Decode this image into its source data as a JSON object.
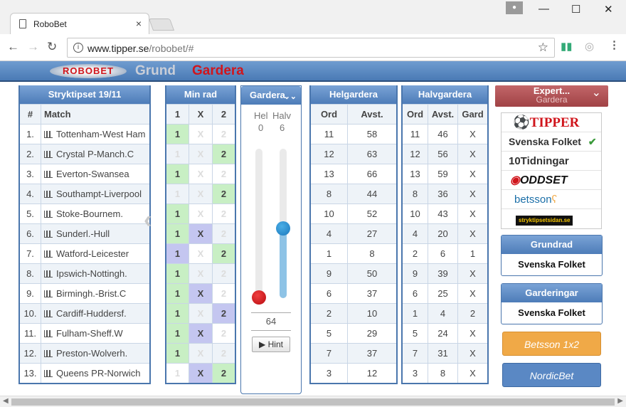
{
  "browser": {
    "tab_title": "RoboBet",
    "tab_close": "×",
    "url_host": "www.tipper.se",
    "url_path": "/robobet/#",
    "min": "—",
    "max": "☐",
    "close": "✕"
  },
  "banner": {
    "logo": "ROBOBET",
    "grund": "Grund",
    "gardera": "Gardera"
  },
  "stryk": {
    "title": "Stryktipset 19/11",
    "col_num": "#",
    "col_match": "Match",
    "matches": [
      "Tottenham-West Ham",
      "Crystal P-Manch.C",
      "Everton-Swansea",
      "Southampt-Liverpool",
      "Stoke-Bournem.",
      "Sunderl.-Hull",
      "Watford-Leicester",
      "Ipswich-Nottingh.",
      "Birmingh.-Brist.C",
      "Cardiff-Huddersf.",
      "Fulham-Sheff.W",
      "Preston-Wolverh.",
      "Queens PR-Norwich"
    ],
    "nums": [
      "1.",
      "2.",
      "3.",
      "4.",
      "5.",
      "6.",
      "7.",
      "8.",
      "9.",
      "10.",
      "11.",
      "12.",
      "13."
    ]
  },
  "minrad": {
    "title": "Min rad",
    "cols": [
      "1",
      "X",
      "2"
    ],
    "rows": [
      [
        "1",
        "",
        ""
      ],
      [
        "",
        "",
        "2"
      ],
      [
        "1",
        "",
        ""
      ],
      [
        "",
        "",
        "2"
      ],
      [
        "1",
        "",
        ""
      ],
      [
        "1",
        "X",
        ""
      ],
      [
        "1",
        "",
        "2"
      ],
      [
        "1",
        "",
        ""
      ],
      [
        "1",
        "X",
        ""
      ],
      [
        "1",
        "",
        "2"
      ],
      [
        "1",
        "X",
        ""
      ],
      [
        "1",
        "",
        ""
      ],
      [
        "",
        "X",
        "2"
      ]
    ],
    "faint": [
      "1",
      "X",
      "2"
    ]
  },
  "gardera": {
    "title": "Gardera",
    "hel_label": "Hel",
    "halv_label": "Halv",
    "hel_value": "0",
    "halv_value": "6",
    "total": "64",
    "hint": "▶ Hint"
  },
  "helgardera": {
    "title": "Helgardera",
    "cols": [
      "Ord",
      "Avst."
    ],
    "rows": [
      [
        "11",
        "58"
      ],
      [
        "12",
        "63"
      ],
      [
        "13",
        "66"
      ],
      [
        "8",
        "44"
      ],
      [
        "10",
        "52"
      ],
      [
        "4",
        "27"
      ],
      [
        "1",
        "8"
      ],
      [
        "9",
        "50"
      ],
      [
        "6",
        "37"
      ],
      [
        "2",
        "10"
      ],
      [
        "5",
        "29"
      ],
      [
        "7",
        "37"
      ],
      [
        "3",
        "12"
      ]
    ]
  },
  "halvgardera": {
    "title": "Halvgardera",
    "cols": [
      "Ord",
      "Avst.",
      "Gard"
    ],
    "rows": [
      [
        "11",
        "46",
        "X"
      ],
      [
        "12",
        "56",
        "X"
      ],
      [
        "13",
        "59",
        "X"
      ],
      [
        "8",
        "36",
        "X"
      ],
      [
        "10",
        "43",
        "X"
      ],
      [
        "4",
        "20",
        "X"
      ],
      [
        "2",
        "6",
        "1"
      ],
      [
        "9",
        "39",
        "X"
      ],
      [
        "6",
        "25",
        "X"
      ],
      [
        "1",
        "4",
        "2"
      ],
      [
        "5",
        "24",
        "X"
      ],
      [
        "7",
        "31",
        "X"
      ],
      [
        "3",
        "8",
        "X"
      ]
    ]
  },
  "expert": {
    "line1": "Expert...",
    "line2": "Gardera"
  },
  "sources": [
    "TIPPER",
    "Svenska Folket",
    "10Tidningar",
    "ODDSET",
    "betsson",
    "stryktipsetsidan.se"
  ],
  "grundrad": {
    "title": "Grundrad",
    "value": "Svenska Folket"
  },
  "garderingar": {
    "title": "Garderingar",
    "value": "Svenska Folket"
  },
  "betsson_btn": "Betsson 1x2",
  "nordic_btn": "NordicBet",
  "colors": {
    "accent": "#4d7cb8",
    "red": "#d0151c",
    "green_cell": "#c8efc4",
    "purple_cell": "#c4c6f0",
    "betsson": "#f0a947",
    "nordic": "#5a88c4"
  }
}
